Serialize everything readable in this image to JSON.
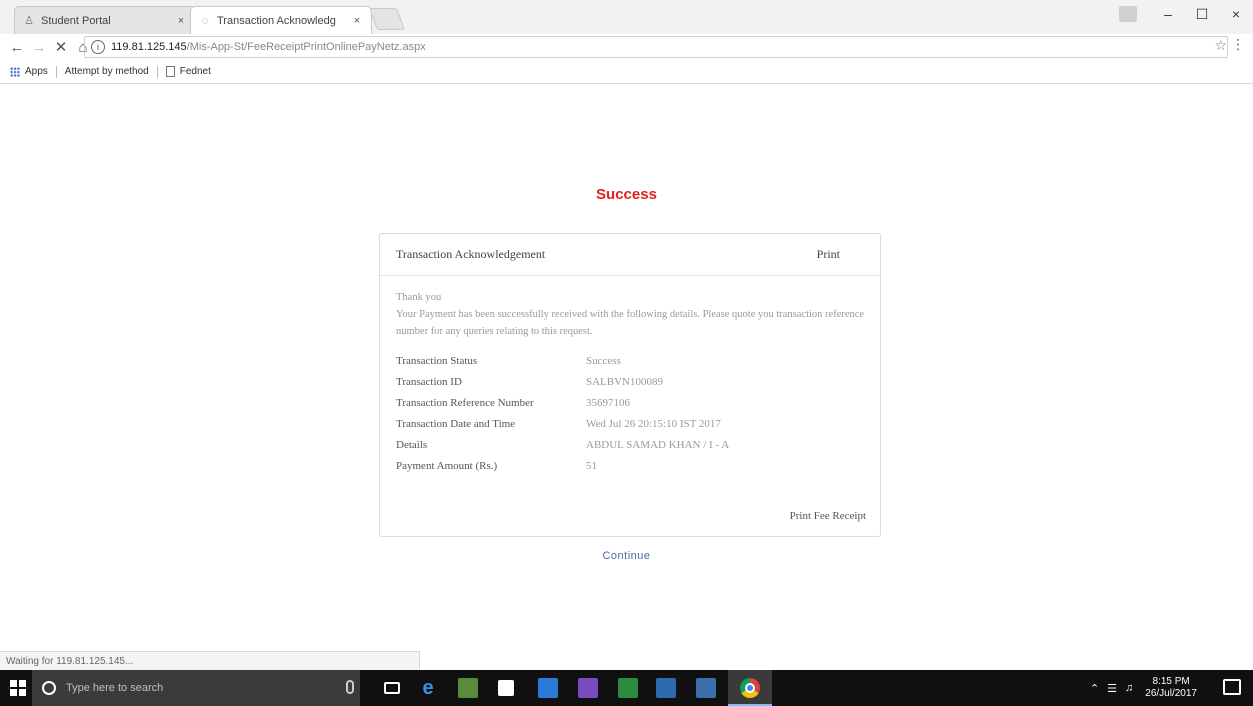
{
  "browser": {
    "tabs": [
      {
        "label": "Student Portal",
        "active": false,
        "icon": "user-favicon"
      },
      {
        "label": "Transaction Acknowledg",
        "active": true,
        "icon": "loading-favicon"
      }
    ],
    "address": {
      "host": "119.81.125.145",
      "path": "/Mis-App-St/FeeReceiptPrintOnlinePayNetz.aspx"
    },
    "bookmarks": [
      "Apps",
      "Attempt by method",
      "Fednet"
    ],
    "window_controls": {
      "minimize": "–",
      "maximize": "☐",
      "close": "×"
    }
  },
  "page": {
    "status_title": "Success",
    "card": {
      "title": "Transaction Acknowledgement",
      "print_label": "Print",
      "thanks": "Thank you",
      "message": "Your Payment has been successfully received with the following details. Please quote you transaction reference number for any queries relating to this request.",
      "details": [
        {
          "label": "Transaction Status",
          "value": "Success"
        },
        {
          "label": "Transaction ID",
          "value": "SALBVN100089"
        },
        {
          "label": "Transaction Reference Number",
          "value": "35697106"
        },
        {
          "label": "Transaction Date and Time",
          "value": "Wed Jul 26 20:15:10 IST 2017"
        },
        {
          "label": "Details",
          "value": "ABDUL SAMAD KHAN / I - A"
        },
        {
          "label": "Payment Amount (Rs.)",
          "value": "51"
        }
      ],
      "print_receipt_label": "Print Fee Receipt"
    },
    "continue_label": "Continue"
  },
  "status_bar": {
    "text": "Waiting for 119.81.125.145..."
  },
  "taskbar": {
    "search_placeholder": "Type here to search",
    "clock_time": "8:15 PM",
    "clock_date": "26/Jul/2017"
  },
  "colors": {
    "success": "#e02020",
    "continue_link": "#4a6aa0"
  }
}
